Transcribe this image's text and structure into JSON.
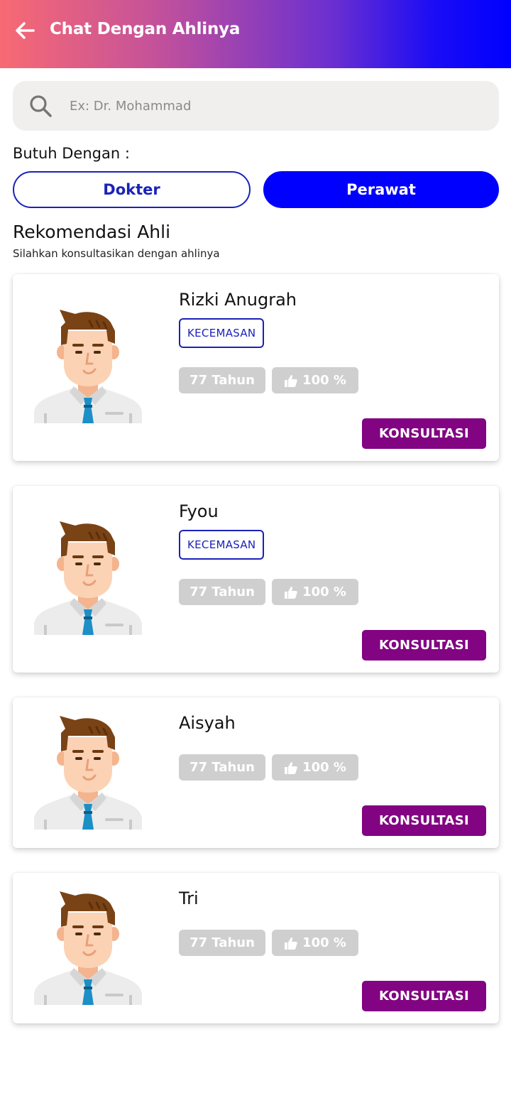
{
  "appbar": {
    "title": "Chat Dengan Ahlinya",
    "back_icon": "arrow-left-icon",
    "gradient": [
      "#f86a73",
      "#0000ff"
    ]
  },
  "search": {
    "placeholder": "Ex: Dr. Mohammad",
    "value": "",
    "icon": "search-icon"
  },
  "filter": {
    "label": "Butuh Dengan :",
    "options": [
      {
        "label": "Dokter",
        "selected": false
      },
      {
        "label": "Perawat",
        "selected": true
      }
    ]
  },
  "section": {
    "title": "Rekomendasi Ahli",
    "subtitle": "Silahkan konsultasikan dengan ahlinya"
  },
  "experts": [
    {
      "name": "Rizki Anugrah",
      "tag": "KECEMASAN",
      "age": "77 Tahun",
      "rating": "100 %",
      "button": "KONSULTASI"
    },
    {
      "name": "Fyou",
      "tag": "KECEMASAN",
      "age": "77 Tahun",
      "rating": "100 %",
      "button": "KONSULTASI"
    },
    {
      "name": "Aisyah",
      "tag": "",
      "age": "77 Tahun",
      "rating": "100 %",
      "button": "KONSULTASI"
    },
    {
      "name": "Tri",
      "tag": "",
      "age": "77 Tahun",
      "rating": "100 %",
      "button": "KONSULTASI"
    }
  ],
  "colors": {
    "primary_blue": "#0000ff",
    "outline_blue": "#1a22b8",
    "button_purple": "#820482",
    "chip_gray": "#cfcfcf"
  }
}
